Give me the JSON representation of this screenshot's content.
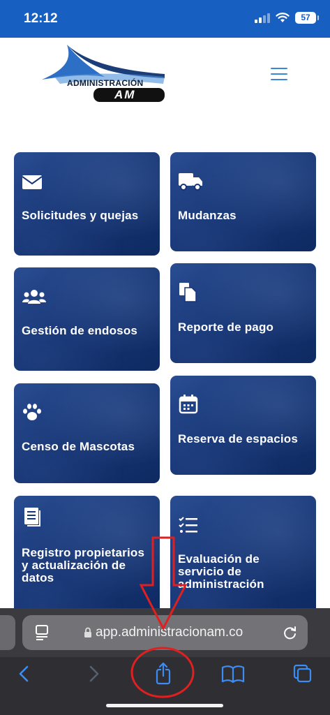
{
  "status_bar": {
    "time": "12:12",
    "battery": "57"
  },
  "header": {
    "logo_text_line1": "ADMINISTRACIÓN",
    "logo_text_line2": "AM"
  },
  "cards": [
    {
      "label": "Solicitudes y quejas",
      "icon": "envelope-icon"
    },
    {
      "label": "Mudanzas",
      "icon": "truck-icon"
    },
    {
      "label": "Gestión de endosos",
      "icon": "users-icon"
    },
    {
      "label": "Reporte de pago",
      "icon": "copy-file-icon"
    },
    {
      "label": "Censo de Mascotas",
      "icon": "paw-icon"
    },
    {
      "label": "Reserva de espacios",
      "icon": "calendar-icon"
    },
    {
      "label_lines": [
        "Registro propietarios",
        "y actualización de",
        "datos"
      ],
      "icon": "document-icon"
    },
    {
      "label_lines": [
        "Evaluación de",
        "servicio de",
        "administración"
      ],
      "icon": "checklist-icon"
    }
  ],
  "browser": {
    "url": "app.administracionam.co"
  },
  "colors": {
    "status_bar": "#1760c2",
    "card": "#163574",
    "annotation": "#e02020",
    "toolbar_icons": "#3b8df5"
  }
}
